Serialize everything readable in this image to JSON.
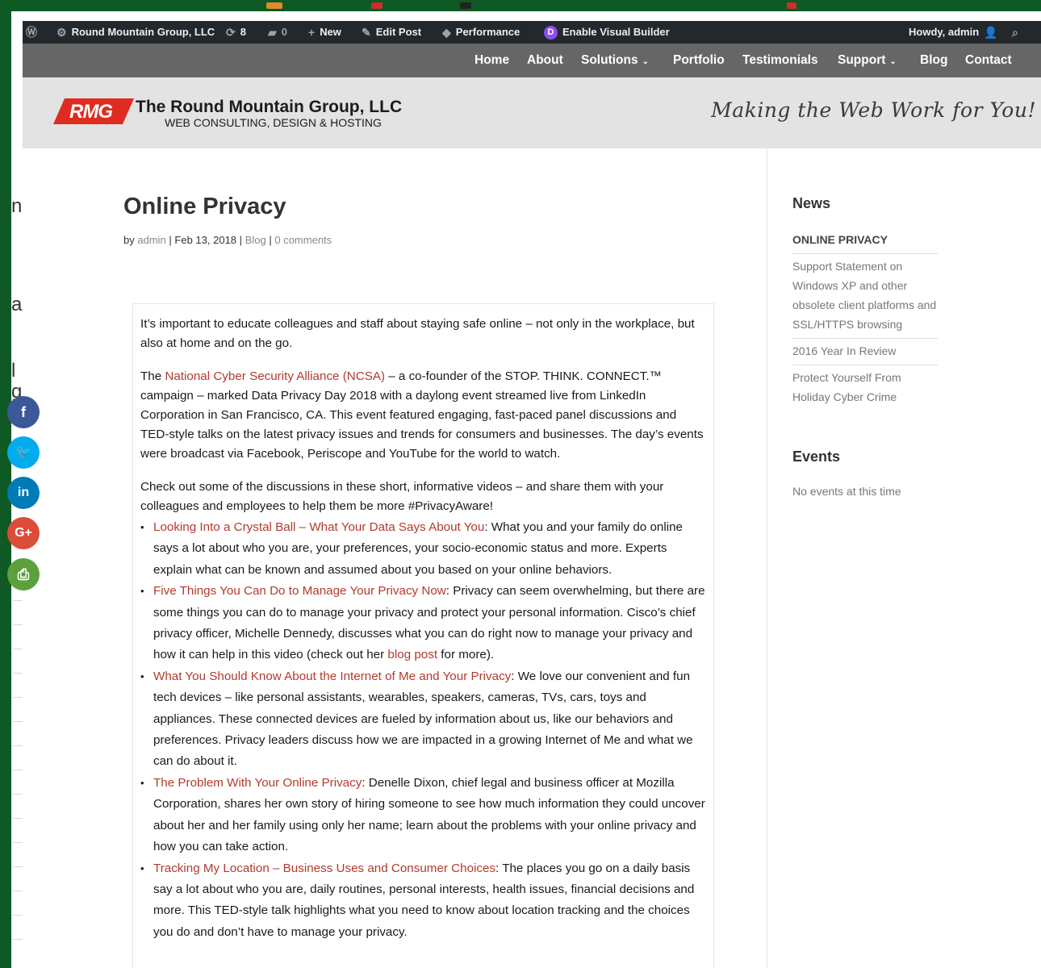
{
  "admin_bar": {
    "site_name": "Round Mountain Group, LLC",
    "updates_count": "8",
    "comments_count": "0",
    "new_label": "New",
    "edit_post_label": "Edit Post",
    "performance_label": "Performance",
    "visual_builder_label": "Enable Visual Builder",
    "howdy_label": "Howdy, admin"
  },
  "nav": {
    "items": [
      "Home",
      "About",
      "Solutions",
      "Portfolio",
      "Testimonials",
      "Support",
      "Blog",
      "Contact"
    ]
  },
  "header": {
    "logo_mark": "RMG",
    "logo_name": "The Round Mountain Group, LLC",
    "logo_sub": "WEB CONSULTING, DESIGN & HOSTING",
    "tagline": "Making the Web Work for You!"
  },
  "post": {
    "title": "Online Privacy",
    "meta": {
      "by": "by",
      "author": "admin",
      "date": "Feb 13, 2018",
      "category": "Blog",
      "comments": "0 comments"
    },
    "intro": "It’s important to educate colleagues and staff about staying safe online – not only in the workplace, but also at home and on the go.",
    "p2_pre": "The ",
    "p2_link": "National Cyber Security Alliance (NCSA)",
    "p2_post": " – a co-founder of the STOP. THINK. CONNECT.™ campaign – marked Data Privacy Day 2018 with a daylong event streamed live from LinkedIn Corporation in San Francisco, CA. This event featured engaging, fast-paced panel discussions and TED-style talks on the latest privacy issues and trends for consumers and businesses. The day’s events were broadcast via Facebook, Periscope and YouTube for the world to watch.",
    "p3": "Check out some of the discussions in these short, informative videos – and share them with your colleagues and employees to help them be more #PrivacyAware!",
    "bullets": [
      {
        "link": "Looking Into a Crystal Ball – What Your Data Says About You",
        "text": ": What you and your family do online says a lot about who you are, your preferences, your socio-economic status and more. Experts explain what can be known and assumed about you based on your online behaviors."
      },
      {
        "link": "Five Things You Can Do to Manage Your Privacy Now",
        "text": ": Privacy can seem overwhelming, but there are some things you can do to manage your privacy and protect your personal information. Cisco’s chief privacy officer, Michelle Dennedy, discusses what you can do right now to manage your privacy and how it can help in this video (check out her ",
        "inline_link": "blog post",
        "tail": " for more)."
      },
      {
        "link": "What You Should Know About the Internet of Me and Your Privacy",
        "text": ": We love our convenient and fun tech devices – like personal assistants, wearables, speakers, cameras, TVs, cars, toys and appliances. These connected devices are fueled by information about us, like our behaviors and preferences. Privacy leaders discuss how we are impacted in a growing Internet of Me and what we can do about it."
      },
      {
        "link": "The Problem With Your Online Privacy",
        "text": ": Denelle Dixon, chief legal and business officer at Mozilla Corporation, shares her own story of hiring someone to see how much information they could uncover about her and her family using only her name; learn about the problems with your online privacy and how you can take action."
      },
      {
        "link": "Tracking My Location – Business Uses and Consumer Choices",
        "text": ": The places you go on a daily basis say a lot about who you are, daily routines, personal interests, health issues, financial decisions and more. This TED-style talk highlights what you need to know about location tracking and the choices you do and don’t have to manage your privacy."
      }
    ]
  },
  "sidebar": {
    "news_title": "News",
    "news_items": [
      "ONLINE PRIVACY",
      "Support Statement on Windows XP and other obsolete client platforms and SSL/HTTPS browsing",
      "2016 Year In Review",
      "Protect Yourself From Holiday Cyber Crime"
    ],
    "events_title": "Events",
    "events_text": "No events at this time"
  },
  "share_buttons": [
    {
      "icon": "facebook-icon",
      "glyph": "f",
      "color": "#3b5998"
    },
    {
      "icon": "twitter-icon",
      "glyph": "🐦",
      "color": "#00aced"
    },
    {
      "icon": "linkedin-icon",
      "glyph": "in",
      "color": "#007bb6"
    },
    {
      "icon": "google-plus-icon",
      "glyph": "G+",
      "color": "#dd4b39"
    },
    {
      "icon": "print-icon",
      "glyph": "⎙",
      "color": "#5ba03c"
    }
  ],
  "colors": {
    "admin_bar": "#23282d",
    "nav_bar": "#666666",
    "header_band": "#e3e3e3",
    "link": "#b33a2e",
    "logo_red": "#e02b20",
    "desktop_green": "#0f5a24"
  },
  "background_fragments": [
    "n",
    "a",
    "l",
    "g"
  ]
}
